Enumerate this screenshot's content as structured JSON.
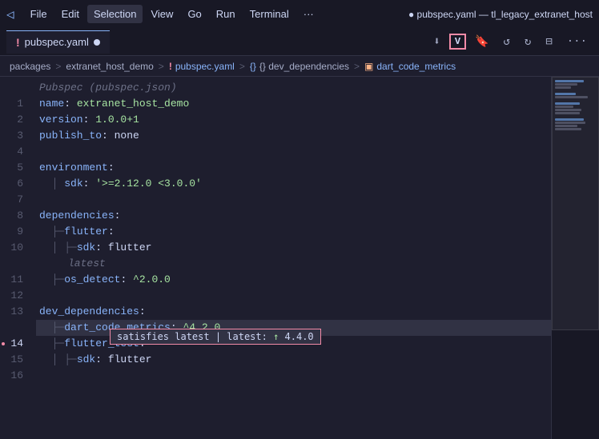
{
  "titlebar": {
    "logo": "◁",
    "menu_items": [
      "File",
      "Edit",
      "Selection",
      "View",
      "Go",
      "Run",
      "Terminal",
      "···"
    ],
    "title": "● pubspec.yaml — tl_legacy_extranet_host",
    "selection_active": true
  },
  "tabbar": {
    "tab_icon": "!",
    "tab_name": "pubspec.yaml",
    "tab_modified": true,
    "actions": [
      "⬇",
      "V",
      "🔖",
      "↺",
      "↻",
      "⊟",
      "···"
    ]
  },
  "breadcrumb": {
    "items": [
      "packages",
      "extranet_host_demo",
      "pubspec.yaml",
      "{} dev_dependencies",
      "dart_code_metrics"
    ],
    "separators": [
      ">",
      ">",
      ">",
      ">"
    ]
  },
  "editor": {
    "hint_text": "Pubspec (pubspec.json)",
    "lines": [
      {
        "num": 1,
        "indent": "",
        "content": "name: extranet_host_demo",
        "type": "key-value"
      },
      {
        "num": 2,
        "indent": "",
        "content": "version: 1.0.0+1",
        "type": "key-value"
      },
      {
        "num": 3,
        "indent": "",
        "content": "publish_to: none",
        "type": "key-value"
      },
      {
        "num": 4,
        "indent": "",
        "content": "",
        "type": "empty"
      },
      {
        "num": 5,
        "indent": "",
        "content": "environment:",
        "type": "key"
      },
      {
        "num": 6,
        "indent": "  │ ",
        "content": "sdk: '>=2.12.0 <3.0.0'",
        "type": "key-value"
      },
      {
        "num": 7,
        "indent": "",
        "content": "",
        "type": "empty"
      },
      {
        "num": 8,
        "indent": "",
        "content": "dependencies:",
        "type": "key"
      },
      {
        "num": 9,
        "indent": "  ├─",
        "content": "flutter:",
        "type": "key-value"
      },
      {
        "num": 10,
        "indent": "  │ ├─",
        "content": "sdk: flutter",
        "type": "key-value"
      },
      {
        "num": 11,
        "indent": "  ├─",
        "content": "os_detect: ^2.0.0",
        "type": "key-value"
      },
      {
        "num": 12,
        "indent": "",
        "content": "",
        "type": "empty"
      },
      {
        "num": 13,
        "indent": "",
        "content": "dev_dependencies:",
        "type": "key"
      },
      {
        "num": 14,
        "indent": "  ├─",
        "content": "dart_code_metrics: ^4.2.0",
        "type": "key-value",
        "active": true
      },
      {
        "num": 15,
        "indent": "  ├─",
        "content": "flutter_test:",
        "type": "key-value"
      },
      {
        "num": 16,
        "indent": "  │ ├─",
        "content": "sdk: flutter",
        "type": "key-value"
      }
    ],
    "tooltip": {
      "text": "satisfies latest | latest: ↑ 4.4.0",
      "line": 14
    },
    "line_hints": {
      "11": "latest",
      "14": "satisfies latest | latest: ↑ 4.4.0"
    }
  }
}
